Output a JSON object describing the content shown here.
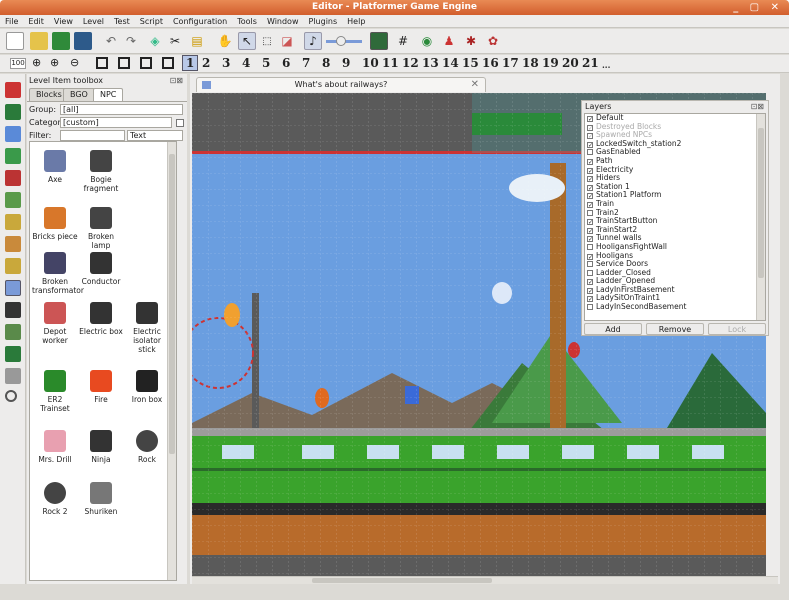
{
  "window": {
    "title": "Editor - Platformer Game Engine",
    "controls": "_ ▢ ✕"
  },
  "menu": [
    "File",
    "Edit",
    "View",
    "Level",
    "Test",
    "Script",
    "Configuration",
    "Tools",
    "Window",
    "Plugins",
    "Help"
  ],
  "toolbar": {
    "zoom": "100",
    "sections": [
      "1",
      "2",
      "3",
      "4",
      "5",
      "6",
      "7",
      "8",
      "9",
      "10",
      "11",
      "12",
      "13",
      "14",
      "15",
      "16",
      "17",
      "18",
      "19",
      "20",
      "21",
      "..."
    ]
  },
  "toolbox": {
    "title": "Level Item toolbox",
    "tabs": [
      "Blocks",
      "BGO",
      "NPC"
    ],
    "active_tab": "NPC",
    "group_label": "Group:",
    "group_value": "[all]",
    "category_label": "Category:",
    "category_value": "[custom]",
    "filter_label": "Filter:",
    "filter_value": "",
    "filter_mode": "Text",
    "items": [
      {
        "name": "Axe"
      },
      {
        "name": "Bogie fragment"
      },
      {
        "name": ""
      },
      {
        "name": "Bricks piece"
      },
      {
        "name": "Broken lamp"
      },
      {
        "name": ""
      },
      {
        "name": "Broken transformator"
      },
      {
        "name": "Conductor"
      },
      {
        "name": ""
      },
      {
        "name": "Depot worker"
      },
      {
        "name": "Electric box"
      },
      {
        "name": "Electric isolator stick"
      },
      {
        "name": "ER2 Trainset"
      },
      {
        "name": "Fire"
      },
      {
        "name": "Iron box"
      },
      {
        "name": "Mrs. Drill"
      },
      {
        "name": "Ninja"
      },
      {
        "name": "Rock"
      },
      {
        "name": "Rock 2"
      },
      {
        "name": "Shuriken"
      },
      {
        "name": ""
      }
    ]
  },
  "document": {
    "tab_title": "What's about railways?",
    "close": "✕"
  },
  "layers": {
    "title": "Layers",
    "items": [
      {
        "name": "Default",
        "checked": true,
        "disabled": false
      },
      {
        "name": "Destroyed Blocks",
        "checked": true,
        "disabled": true
      },
      {
        "name": "Spawned NPCs",
        "checked": true,
        "disabled": true
      },
      {
        "name": "LockedSwitch_station2",
        "checked": true,
        "disabled": false
      },
      {
        "name": "GasEnabled",
        "checked": false,
        "disabled": false
      },
      {
        "name": "Path",
        "checked": true,
        "disabled": false
      },
      {
        "name": "Electricity",
        "checked": true,
        "disabled": false
      },
      {
        "name": "Hiders",
        "checked": true,
        "disabled": false
      },
      {
        "name": "Station 1",
        "checked": true,
        "disabled": false
      },
      {
        "name": "Station1 Platform",
        "checked": true,
        "disabled": false
      },
      {
        "name": "Train",
        "checked": true,
        "disabled": false
      },
      {
        "name": "Train2",
        "checked": false,
        "disabled": false
      },
      {
        "name": "TrainStartButton",
        "checked": true,
        "disabled": false
      },
      {
        "name": "TrainStart2",
        "checked": true,
        "disabled": false
      },
      {
        "name": "Tunnel walls",
        "checked": true,
        "disabled": false
      },
      {
        "name": "HooligansFightWall",
        "checked": false,
        "disabled": false
      },
      {
        "name": "Hooligans",
        "checked": true,
        "disabled": false
      },
      {
        "name": "Service Doors",
        "checked": false,
        "disabled": false
      },
      {
        "name": "Ladder_Closed",
        "checked": false,
        "disabled": false
      },
      {
        "name": "Ladder_Opened",
        "checked": true,
        "disabled": false
      },
      {
        "name": "LadyInFirstBasement",
        "checked": true,
        "disabled": false
      },
      {
        "name": "LadySitOnTraint1",
        "checked": true,
        "disabled": false
      },
      {
        "name": "LadyInSecondBasement",
        "checked": false,
        "disabled": false
      }
    ],
    "buttons": {
      "add": "Add",
      "remove": "Remove",
      "lock": "Lock"
    }
  },
  "colors": {
    "titlebar": "#d9652f",
    "sky": "#5f95d6",
    "grass": "#1f7a2a",
    "train": "#3aa32c",
    "dirt": "#b86b2b"
  }
}
